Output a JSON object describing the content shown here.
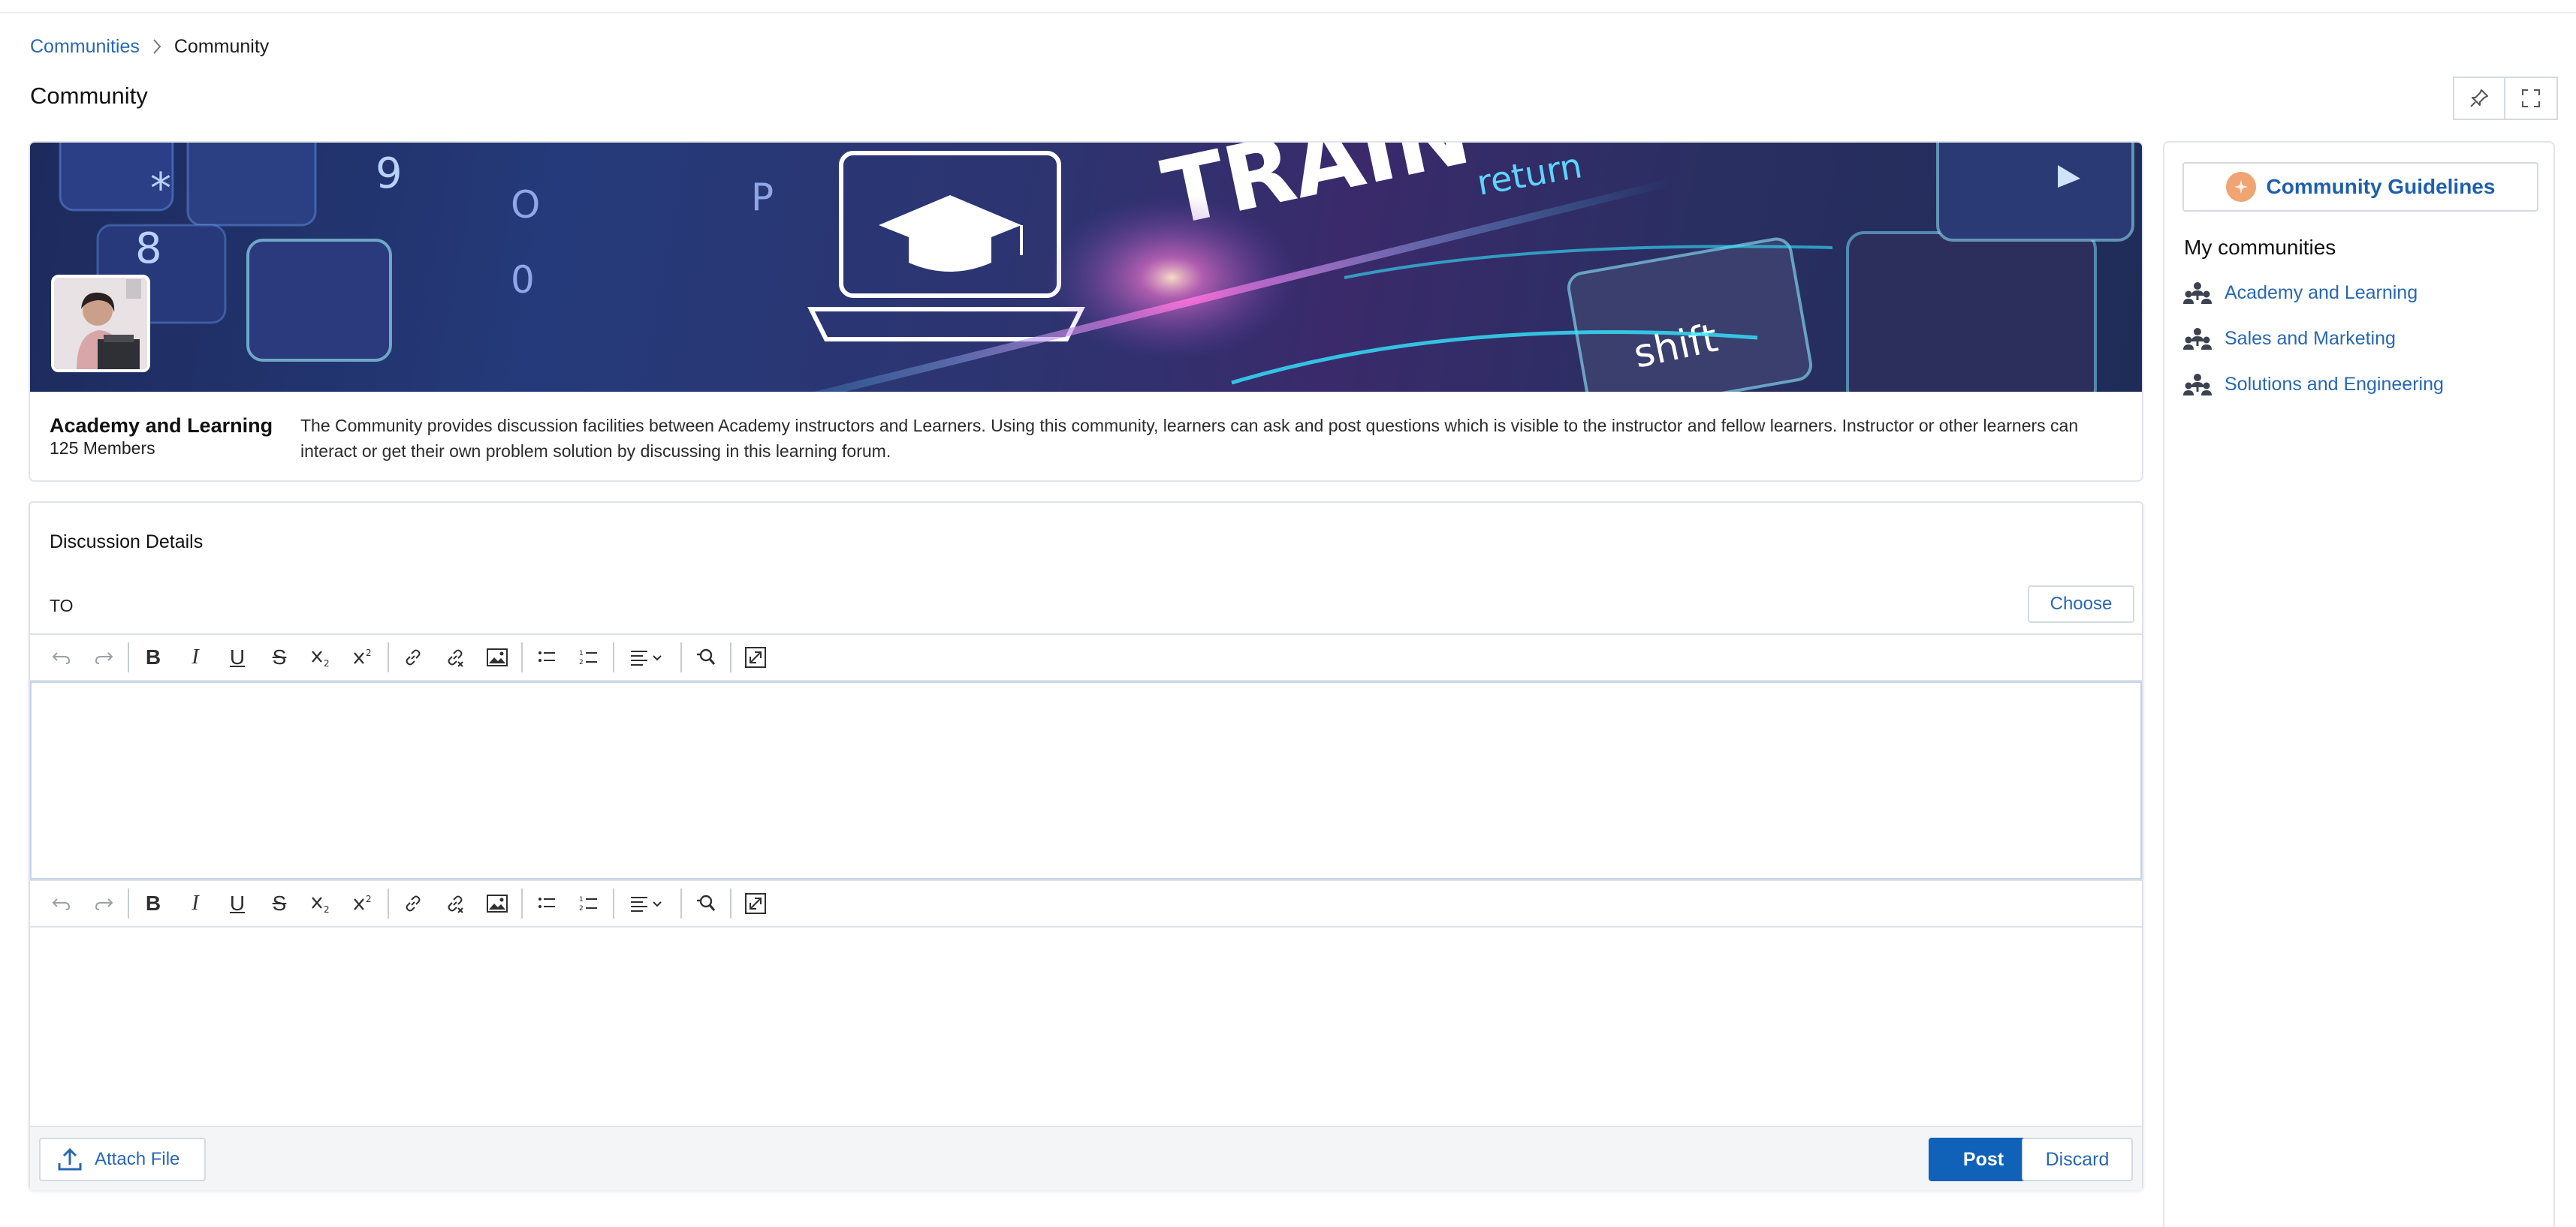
{
  "breadcrumb": {
    "parent": "Communities",
    "current": "Community"
  },
  "page": {
    "title": "Community"
  },
  "top_actions": {
    "pin_icon": "pin-icon",
    "fullscreen_icon": "fullscreen-icon"
  },
  "community": {
    "name": "Academy and Learning",
    "members": "125 Members",
    "description": "The Community provides discussion facilities between Academy instructors and Learners. Using this community, learners can ask and post questions which is visible to the instructor and fellow learners. Instructor or other learners can interact or get their own problem solution by discussing in this learning forum.",
    "banner_words": {
      "train": "TRAIN",
      "return": "return",
      "shift": "shift"
    }
  },
  "discussion": {
    "title": "Discussion Details",
    "to_label": "TO",
    "choose_label": "Choose",
    "toolbar_icons": [
      "undo-icon",
      "redo-icon",
      "bold-icon",
      "italic-icon",
      "underline-icon",
      "strikethrough-icon",
      "subscript-icon",
      "superscript-icon",
      "link-icon",
      "unlink-icon",
      "image-icon",
      "bullet-list-icon",
      "numbered-list-icon",
      "align-icon",
      "find-replace-icon",
      "fullscreen-icon"
    ],
    "toolbar_text": {
      "bold": "B",
      "italic": "I",
      "underline": "U",
      "strike": "S"
    },
    "attach_label": "Attach File",
    "post_label": "Post",
    "discard_label": "Discard"
  },
  "sidebar": {
    "guidelines_label": "Community Guidelines",
    "my_communities_title": "My communities",
    "communities": [
      {
        "label": "Academy and Learning"
      },
      {
        "label": "Sales and Marketing"
      },
      {
        "label": "Solutions and Engineering"
      }
    ]
  },
  "colors": {
    "link": "#2867b2",
    "primary_button": "#0f62b8",
    "guidelines_icon": "#f0a373",
    "border": "#dfe2e7"
  }
}
